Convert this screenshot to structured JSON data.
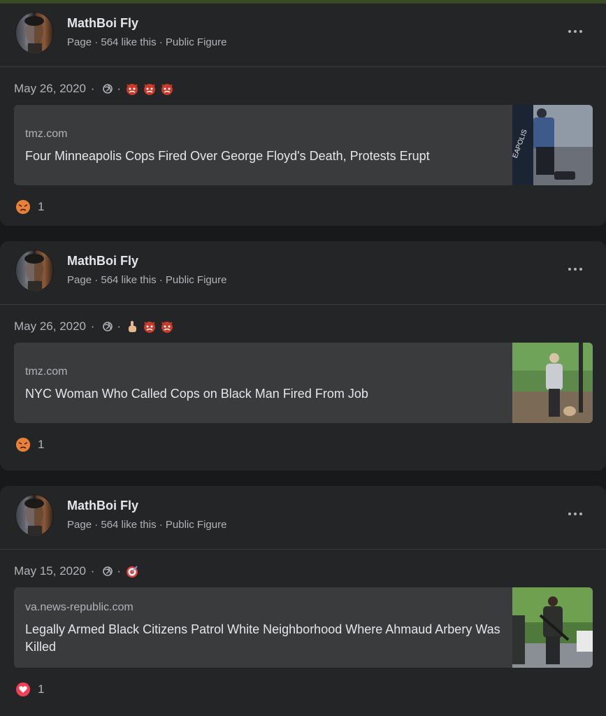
{
  "posts": [
    {
      "author": "MathBoi Fly",
      "meta": "Page · 564 like this · Public Figure",
      "date": "May 26, 2020",
      "reaction_icons": [
        "angry-face-icon",
        "angry-face-icon",
        "angry-face-icon"
      ],
      "link": {
        "domain": "tmz.com",
        "headline": "Four Minneapolis Cops Fired Over George Floyd's Death, Protests Erupt"
      },
      "reaction": {
        "icon": "angry-reaction-icon",
        "count": "1"
      }
    },
    {
      "author": "MathBoi Fly",
      "meta": "Page · 564 like this · Public Figure",
      "date": "May 26, 2020",
      "reaction_icons": [
        "middle-finger-icon",
        "angry-face-icon",
        "angry-face-icon"
      ],
      "link": {
        "domain": "tmz.com",
        "headline": "NYC Woman Who Called Cops on Black Man Fired From Job"
      },
      "reaction": {
        "icon": "angry-reaction-icon",
        "count": "1"
      }
    },
    {
      "author": "MathBoi Fly",
      "meta": "Page · 564 like this · Public Figure",
      "date": "May 15, 2020",
      "reaction_icons": [
        "target-icon"
      ],
      "link": {
        "domain": "va.news-republic.com",
        "headline": "Legally Armed Black Citizens Patrol White Neighborhood Where Ahmaud Arbery Was Killed"
      },
      "reaction": {
        "icon": "love-reaction-icon",
        "count": "1"
      }
    }
  ],
  "colors": {
    "background": "#18191a",
    "card": "#242526",
    "link_box": "#3a3b3c",
    "primary_text": "#e4e6eb",
    "secondary_text": "#b0b3b8",
    "angry": "#f0a03c",
    "love": "#f33e58"
  }
}
